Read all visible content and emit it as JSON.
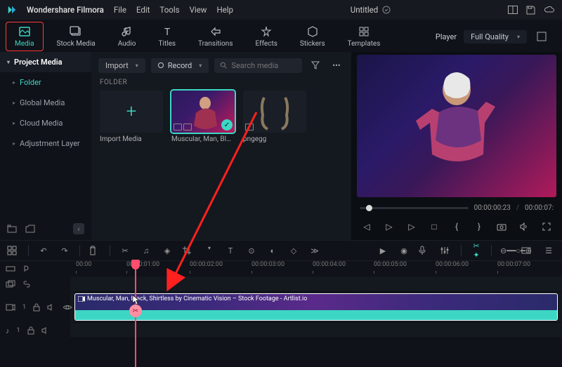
{
  "app": {
    "name": "Wondershare Filmora",
    "document": "Untitled"
  },
  "menubar": [
    "File",
    "Edit",
    "Tools",
    "View",
    "Help"
  ],
  "tabs": [
    {
      "label": "Media",
      "active": true
    },
    {
      "label": "Stock Media"
    },
    {
      "label": "Audio"
    },
    {
      "label": "Titles"
    },
    {
      "label": "Transitions"
    },
    {
      "label": "Effects"
    },
    {
      "label": "Stickers"
    },
    {
      "label": "Templates"
    }
  ],
  "player": {
    "label": "Player",
    "quality": "Full Quality",
    "time_current": "00:00:00:23",
    "time_total": "00:00:07:"
  },
  "sidebar": {
    "header": "Project Media",
    "items": [
      {
        "label": "Folder",
        "kind": "folder"
      },
      {
        "label": "Global Media"
      },
      {
        "label": "Cloud Media"
      },
      {
        "label": "Adjustment Layer"
      }
    ]
  },
  "media": {
    "import": "Import",
    "record": "Record",
    "search_placeholder": "Search media",
    "section": "FOLDER",
    "items": [
      {
        "label": "Import Media",
        "kind": "import"
      },
      {
        "label": "Muscular, Man, Black,...",
        "kind": "video",
        "selected": true
      },
      {
        "label": "pngegg",
        "kind": "image"
      }
    ]
  },
  "ruler": [
    "00:00",
    "00:00:01:00",
    "00:00:02:00",
    "00:00:03:00",
    "00:00:04:00",
    "00:00:05:00",
    "00:00:06:00",
    "00:00:07:00"
  ],
  "clip": {
    "title": "Muscular, Man, Black, Shirtless by Cinematic Vision – Stock Footage - Artlist.io"
  },
  "colors": {
    "accent": "#3dd6c4",
    "danger": "#ff4d6d",
    "highlight": "#ff3b3b"
  }
}
